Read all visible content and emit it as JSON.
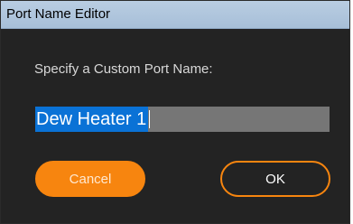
{
  "window": {
    "title": "Port Name Editor"
  },
  "dialog": {
    "prompt": "Specify a Custom Port Name:",
    "port_name_value": "Dew Heater 1",
    "cancel_label": "Cancel",
    "ok_label": "OK"
  },
  "colors": {
    "accent": "#f7850f",
    "background": "#232323",
    "selection": "#0a72d6",
    "input_background": "#767676",
    "titlebar": "#b0c6dd"
  }
}
